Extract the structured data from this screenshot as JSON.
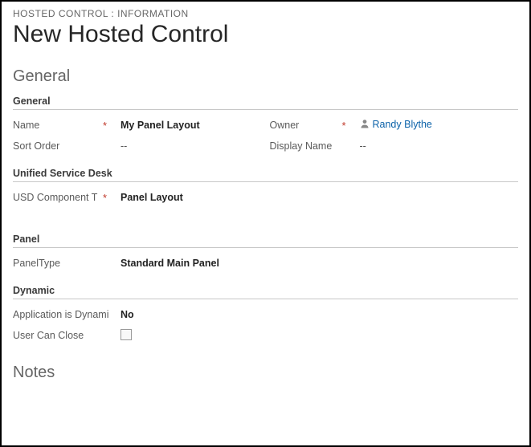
{
  "breadcrumb": "HOSTED CONTROL : INFORMATION",
  "page_title": "New Hosted Control",
  "sections": {
    "general_title": "General",
    "general": {
      "heading": "General",
      "name_label": "Name",
      "name_value": "My Panel Layout",
      "sort_order_label": "Sort Order",
      "sort_order_value": "--",
      "owner_label": "Owner",
      "owner_value": "Randy Blythe",
      "display_name_label": "Display Name",
      "display_name_value": "--"
    },
    "usd": {
      "heading": "Unified Service Desk",
      "component_type_label": "USD Component T",
      "component_type_value": "Panel Layout"
    },
    "panel": {
      "heading": "Panel",
      "panel_type_label": "PanelType",
      "panel_type_value": "Standard Main Panel"
    },
    "dynamic": {
      "heading": "Dynamic",
      "app_dynamic_label": "Application is Dynami",
      "app_dynamic_value": "No",
      "user_can_close_label": "User Can Close",
      "user_can_close_checked": false
    },
    "notes_title": "Notes"
  },
  "required_marker": "*"
}
